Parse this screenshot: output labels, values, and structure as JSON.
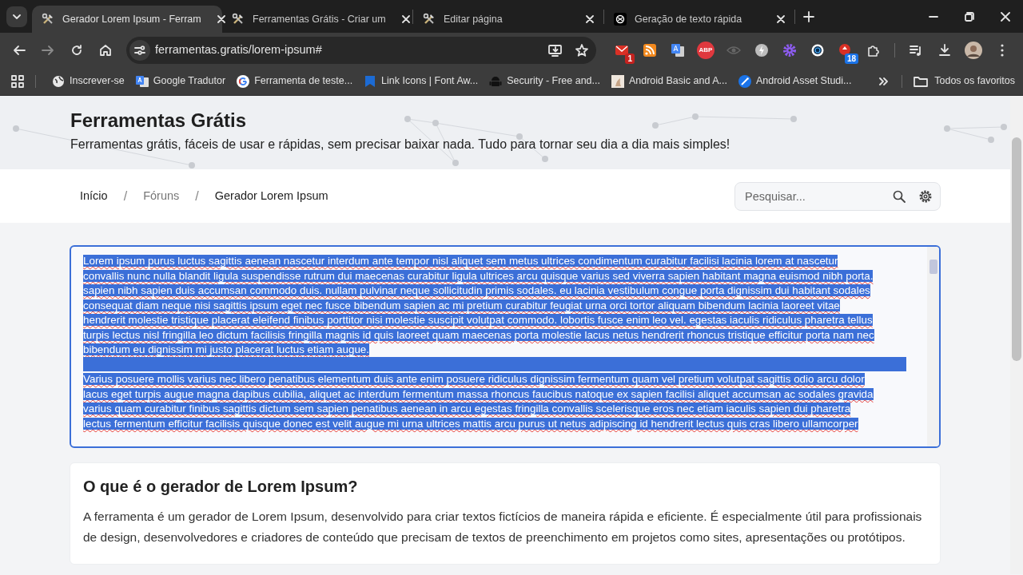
{
  "browser": {
    "tabs": [
      {
        "title": "Gerador Lorem Ipsum - Ferram",
        "kind": "tools",
        "selected": true
      },
      {
        "title": "Ferramentas Grátis - Criar um",
        "kind": "tools",
        "selected": false
      },
      {
        "title": "Editar página",
        "kind": "tools",
        "selected": false
      },
      {
        "title": "Geração de texto rápida",
        "kind": "knot",
        "selected": false
      }
    ],
    "url": "ferramentas.gratis/lorem-ipsum#",
    "extensions": [
      {
        "kind": "mail",
        "badge": "1"
      },
      {
        "kind": "rss"
      },
      {
        "kind": "translate"
      },
      {
        "kind": "abp",
        "label": "ABP"
      },
      {
        "kind": "eye"
      },
      {
        "kind": "bolt"
      },
      {
        "kind": "gear"
      },
      {
        "kind": "ring"
      },
      {
        "kind": "shield",
        "badge": "18"
      },
      {
        "kind": "puzzle"
      }
    ],
    "bookmarks": [
      {
        "label": "Inscrever-se",
        "kind": "globe"
      },
      {
        "label": "Google Tradutor",
        "kind": "translate"
      },
      {
        "label": "Ferramenta de teste...",
        "kind": "g"
      },
      {
        "label": "Link Icons | Font Aw...",
        "kind": "flag"
      },
      {
        "label": "Security - Free and...",
        "kind": "android"
      },
      {
        "label": "Android Basic and A...",
        "kind": "image"
      },
      {
        "label": "Android Asset Studi...",
        "kind": "wand"
      }
    ],
    "all_bookmarks": "Todos os favoritos"
  },
  "site": {
    "title": "Ferramentas Grátis",
    "tagline": "Ferramentas grátis, fáceis de usar e rápidas, sem precisar baixar nada. Tudo para tornar seu dia a dia mais simples!"
  },
  "breadcrumbs": [
    {
      "label": "Início"
    },
    {
      "label": "Fóruns"
    },
    {
      "label": "Gerador Lorem Ipsum"
    }
  ],
  "breadcrumb_separator": "/",
  "search": {
    "placeholder": "Pesquisar..."
  },
  "generator": {
    "selected": true,
    "paragraphs": [
      [
        "Lorem ipsum purus luctus sagittis aenean nascetur interdum ante tempor nisl aliquet sem metus ultrices condimentum curabitur facilisi lacinia lorem at nascetur",
        "convallis nunc nulla blandit ligula suspendisse rutrum dui maecenas curabitur ligula ultrices arcu quisque varius sed viverra sapien habitant magna euismod nibh porta.",
        "sapien nibh sapien duis accumsan commodo duis. nullam pulvinar neque sollicitudin primis sodales. eu lacinia vestibulum congue porta dignissim dui habitant sodales",
        "consequat diam neque nisi sagittis ipsum eget nec fusce bibendum sapien ac mi pretium curabitur feugiat urna orci tortor aliquam bibendum lacinia laoreet vitae",
        "hendrerit molestie tristique placerat eleifend finibus porttitor nisi molestie suscipit volutpat commodo. lobortis fusce enim leo vel. egestas iaculis ridiculus pharetra tellus",
        "turpis lectus nisl fringilla leo dictum facilisis fringilla magnis id quis laoreet quam maecenas porta molestie lacus netus hendrerit rhoncus tristique efficitur porta nam nec",
        "bibendum eu dignissim mi justo placerat luctus etiam augue."
      ],
      [
        "Varius posuere mollis varius nec libero penatibus elementum duis ante enim posuere ridiculus dignissim fermentum quam vel pretium volutpat sagittis odio arcu dolor",
        "lacus eget turpis augue magna dapibus cubilia, aliquet ac interdum fermentum massa rhoncus faucibus natoque ex sapien facilisi aliquet accumsan ac sodales gravida",
        "varius quam curabitur finibus sagittis dictum sem sapien penatibus aenean in arcu egestas fringilla convallis scelerisque eros nec etiam iaculis sapien dui pharetra",
        "lectus fermentum efficitur facilisis quisque donec est velit augue mi urna ultrices mattis arcu purus ut netus adipiscing id hendrerit lectus quis cras libero ullamcorper"
      ]
    ]
  },
  "about": {
    "heading": "O que é o gerador de Lorem Ipsum?",
    "text": "A ferramenta é um gerador de Lorem Ipsum, desenvolvido para criar textos fictícios de maneira rápida e eficiente. É especialmente útil para profissionais de design, desenvolvedores e criadores de conteúdo que precisam de textos de preenchimento em projetos como sites, apresentações ou protótipos."
  }
}
